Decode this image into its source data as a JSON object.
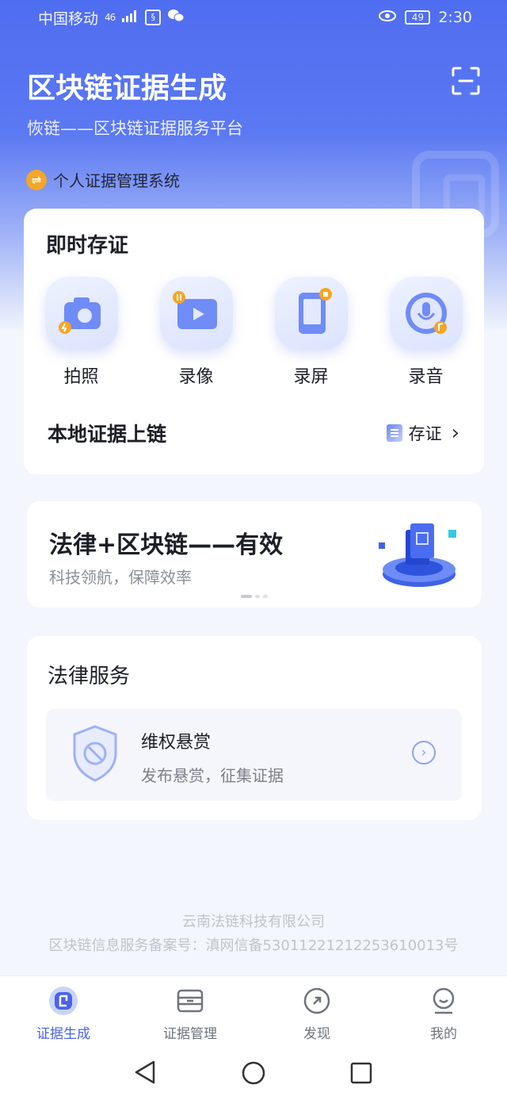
{
  "status_bar": {
    "carrier": "中国移动",
    "network": "46",
    "battery": "49",
    "time": "2:30"
  },
  "header": {
    "title": "区块链证据生成",
    "subtitle": "恢链——区块链证据服务平台",
    "system_label": "个人证据管理系统",
    "system_icon": "⇌"
  },
  "instant": {
    "title": "即时存证",
    "tools": [
      {
        "label": "拍照",
        "icon": "camera-icon"
      },
      {
        "label": "录像",
        "icon": "video-icon"
      },
      {
        "label": "录屏",
        "icon": "screen-record-icon"
      },
      {
        "label": "录音",
        "icon": "microphone-icon"
      }
    ],
    "upload_title": "本地证据上链",
    "upload_action": "存证",
    "chevron": "›"
  },
  "banner": {
    "title": "法律+区块链——有效",
    "subtitle": "科技领航，保障效率"
  },
  "legal": {
    "title": "法律服务",
    "reward_title": "维权悬赏",
    "reward_subtitle": "发布悬赏，征集证据",
    "arrow": "›"
  },
  "footer": {
    "company": "云南法链科技有限公司",
    "icp": "区块链信息服务备案号：滇网信备53011221212253610013号"
  },
  "tabs": [
    {
      "label": "证据生成",
      "active": true
    },
    {
      "label": "证据管理",
      "active": false
    },
    {
      "label": "发现",
      "active": false
    },
    {
      "label": "我的",
      "active": false
    }
  ],
  "colors": {
    "accent": "#4a63e8",
    "hero_top": "#4f6df0",
    "system_badge": "#f2a62b"
  }
}
